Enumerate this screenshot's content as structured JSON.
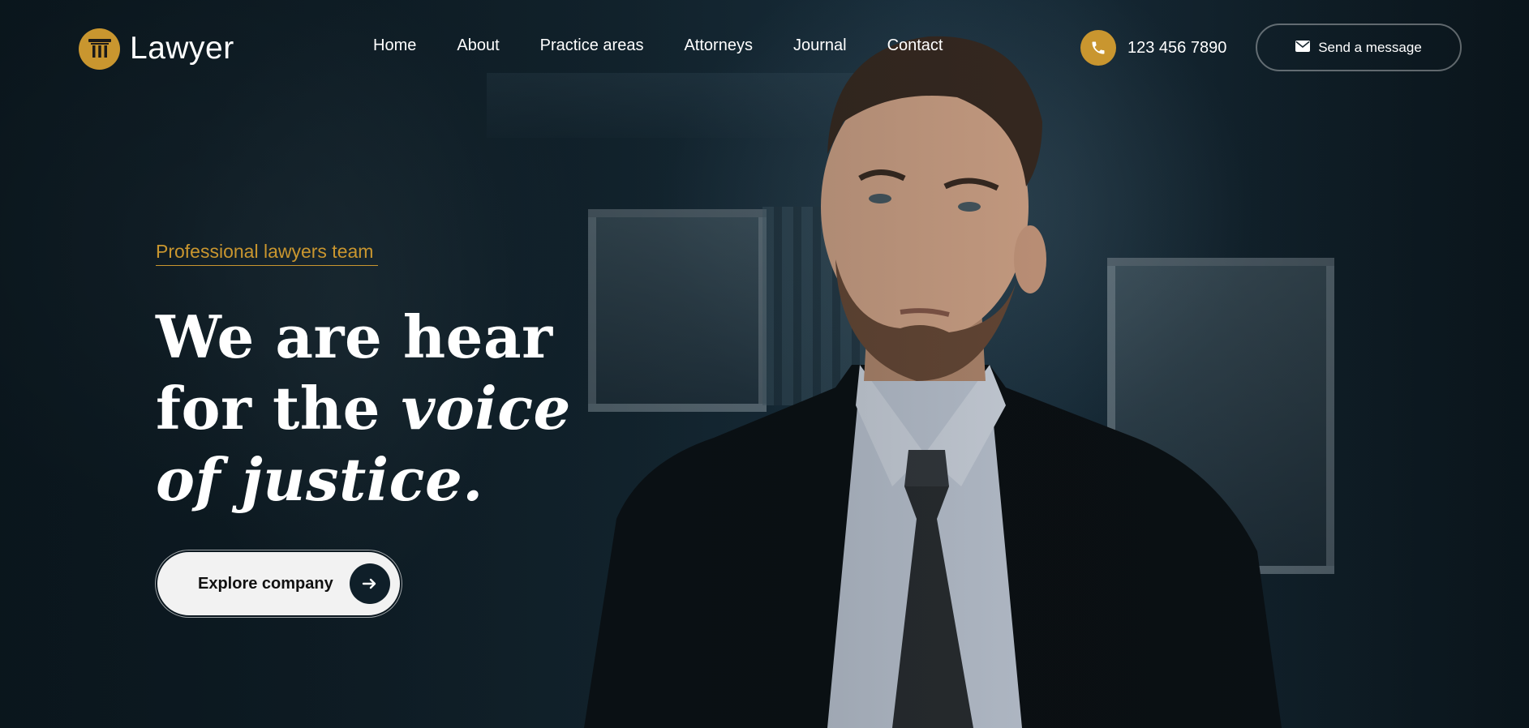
{
  "brand": {
    "name": "Lawyer",
    "logo_icon": "pillar-icon",
    "accent_color": "#c9962f"
  },
  "nav": {
    "items": [
      {
        "label": "Home"
      },
      {
        "label": "About"
      },
      {
        "label": "Practice areas"
      },
      {
        "label": "Attorneys"
      },
      {
        "label": "Journal"
      },
      {
        "label": "Contact"
      }
    ]
  },
  "contact": {
    "phone_icon": "phone-icon",
    "phone": "123 456 7890",
    "send_icon": "envelope-icon",
    "send_label": "Send a message"
  },
  "hero": {
    "eyebrow": "Professional lawyers team",
    "headline_line1": "We are hear",
    "headline_line2_plain": "for the ",
    "headline_line2_italic": "voice",
    "headline_line3": "of justice.",
    "cta_label": "Explore company",
    "cta_icon": "arrow-right-icon"
  }
}
